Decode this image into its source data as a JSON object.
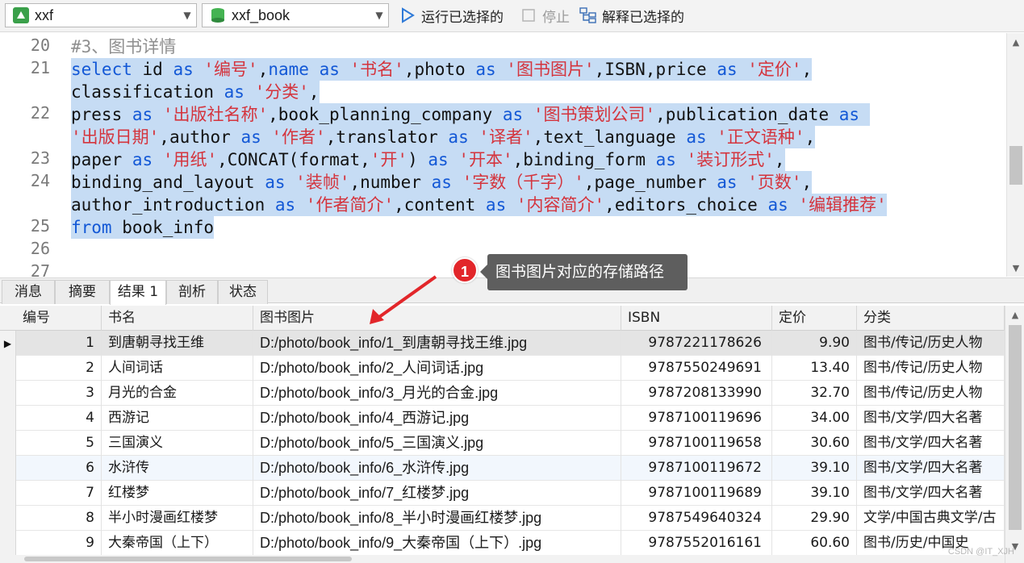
{
  "toolbar": {
    "connection": "xxf",
    "database": "xxf_book",
    "run_selected": "运行已选择的",
    "stop": "停止",
    "explain_selected": "解释已选择的"
  },
  "editor": {
    "line_numbers": [
      "20",
      "21",
      "",
      "22",
      "",
      "23",
      "24",
      "",
      "25",
      "26",
      "27"
    ],
    "comment": "#3、图书详情"
  },
  "tabs": [
    "消息",
    "摘要",
    "结果 1",
    "剖析",
    "状态"
  ],
  "active_tab": "结果 1",
  "annotation": {
    "badge": "1",
    "text": "图书图片对应的存储路径"
  },
  "grid": {
    "columns": [
      "编号",
      "书名",
      "图书图片",
      "ISBN",
      "定价",
      "分类"
    ],
    "rows": [
      {
        "id": "1",
        "name": "到唐朝寻找王维",
        "photo": "D:/photo/book_info/1_到唐朝寻找王维.jpg",
        "isbn": "9787221178626",
        "price": "9.90",
        "cls": "图书/传记/历史人物"
      },
      {
        "id": "2",
        "name": "人间词话",
        "photo": "D:/photo/book_info/2_人间词话.jpg",
        "isbn": "9787550249691",
        "price": "13.40",
        "cls": "图书/传记/历史人物"
      },
      {
        "id": "3",
        "name": "月光的合金",
        "photo": "D:/photo/book_info/3_月光的合金.jpg",
        "isbn": "9787208133990",
        "price": "32.70",
        "cls": "图书/传记/历史人物"
      },
      {
        "id": "4",
        "name": "西游记",
        "photo": "D:/photo/book_info/4_西游记.jpg",
        "isbn": "9787100119696",
        "price": "34.00",
        "cls": "图书/文学/四大名著"
      },
      {
        "id": "5",
        "name": "三国演义",
        "photo": "D:/photo/book_info/5_三国演义.jpg",
        "isbn": "9787100119658",
        "price": "30.60",
        "cls": "图书/文学/四大名著"
      },
      {
        "id": "6",
        "name": "水浒传",
        "photo": "D:/photo/book_info/6_水浒传.jpg",
        "isbn": "9787100119672",
        "price": "39.10",
        "cls": "图书/文学/四大名著"
      },
      {
        "id": "7",
        "name": "红楼梦",
        "photo": "D:/photo/book_info/7_红楼梦.jpg",
        "isbn": "9787100119689",
        "price": "39.10",
        "cls": "图书/文学/四大名著"
      },
      {
        "id": "8",
        "name": "半小时漫画红楼梦",
        "photo": "D:/photo/book_info/8_半小时漫画红楼梦.jpg",
        "isbn": "9787549640324",
        "price": "29.90",
        "cls": "文学/中国古典文学/古"
      },
      {
        "id": "9",
        "name": "大秦帝国（上下）",
        "photo": "D:/photo/book_info/9_大秦帝国（上下）.jpg",
        "isbn": "9787552016161",
        "price": "60.60",
        "cls": "图书/历史/中国史"
      }
    ]
  },
  "watermark": "CSDN @IT_XJH",
  "colors": {
    "keyword": "#1358d6",
    "string": "#d4343d",
    "selection": "#c6dcf4",
    "badge": "#e2262a"
  }
}
